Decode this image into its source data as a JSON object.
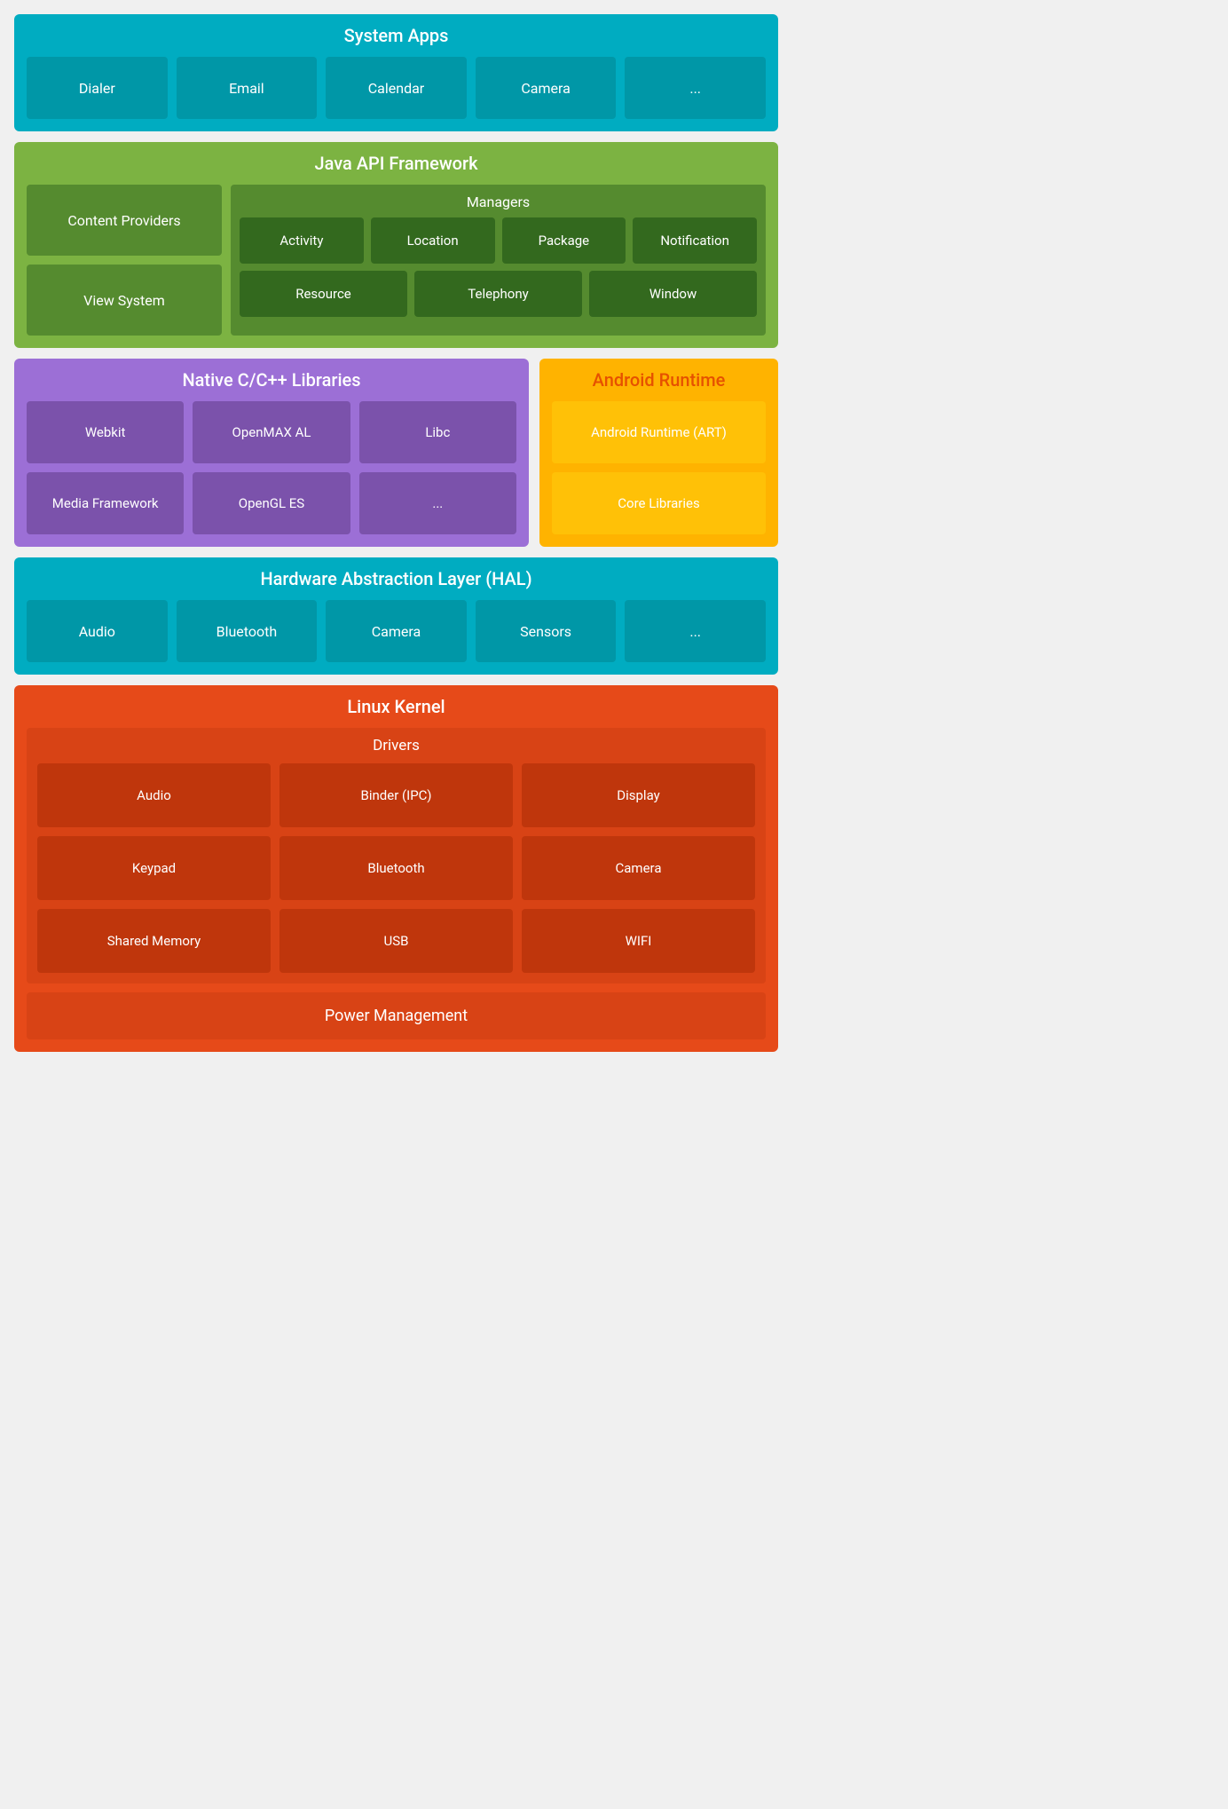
{
  "system_apps": {
    "title": "System Apps",
    "items": [
      "Dialer",
      "Email",
      "Calendar",
      "Camera",
      "..."
    ]
  },
  "java_api": {
    "title": "Java API Framework",
    "content_providers": "Content Providers",
    "view_system": "View System",
    "managers": {
      "title": "Managers",
      "row1": [
        "Activity",
        "Location",
        "Package",
        "Notification"
      ],
      "row2": [
        "Resource",
        "Telephony",
        "Window"
      ]
    }
  },
  "native_libs": {
    "title": "Native C/C++ Libraries",
    "items": [
      "Webkit",
      "OpenMAX AL",
      "Libc",
      "Media Framework",
      "OpenGL ES",
      "..."
    ]
  },
  "android_runtime": {
    "title": "Android Runtime",
    "items": [
      "Android Runtime (ART)",
      "Core Libraries"
    ]
  },
  "hal": {
    "title": "Hardware Abstraction Layer (HAL)",
    "items": [
      "Audio",
      "Bluetooth",
      "Camera",
      "Sensors",
      "..."
    ]
  },
  "linux_kernel": {
    "title": "Linux Kernel",
    "drivers_title": "Drivers",
    "drivers": [
      "Audio",
      "Binder (IPC)",
      "Display",
      "Keypad",
      "Bluetooth",
      "Camera",
      "Shared Memory",
      "USB",
      "WIFI"
    ],
    "power_management": "Power Management"
  }
}
